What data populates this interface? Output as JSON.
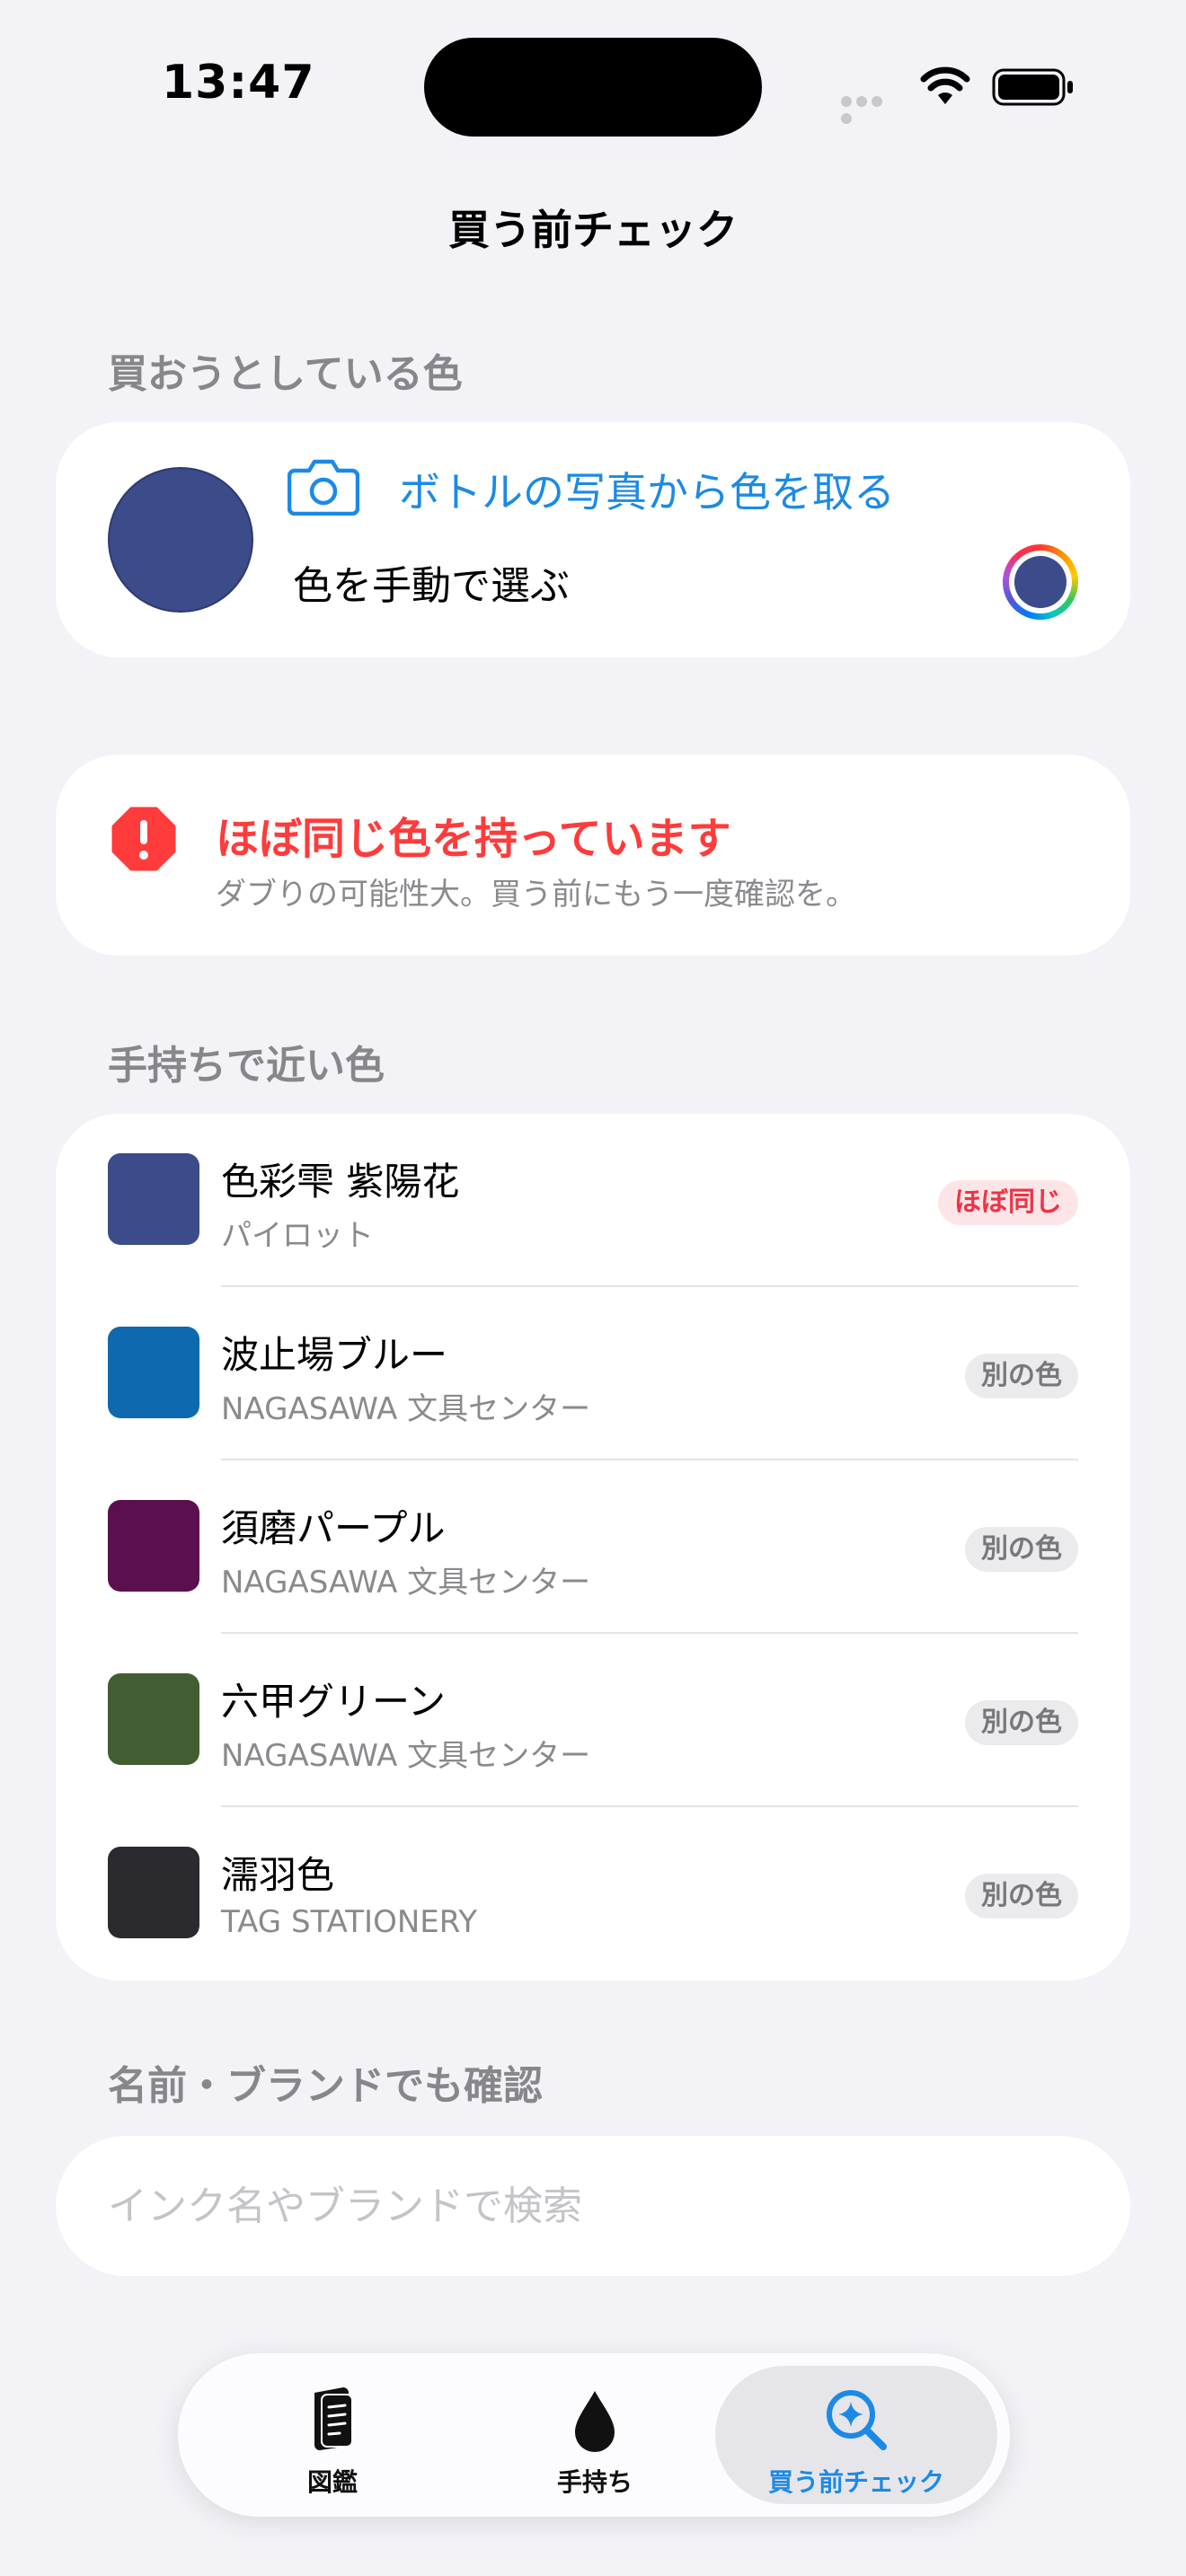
{
  "status_bar": {
    "time": "13:47"
  },
  "nav": {
    "title": "買う前チェック"
  },
  "picker": {
    "section_label": "買おうとしている色",
    "selected_color": "#3c4b89",
    "photo_link": "ボトルの写真から色を取る",
    "manual_label": "色を手動で選ぶ"
  },
  "warning": {
    "title": "ほぼ同じ色を持っています",
    "subtitle": "ダブりの可能性大。買う前にもう一度確認を。",
    "color": "#ff3b3b"
  },
  "owned": {
    "section_label": "手持ちで近い色",
    "items": [
      {
        "name": "色彩雫 紫陽花",
        "brand": "パイロット",
        "color": "#3c4b89",
        "badge": "ほぼ同じ",
        "status": "same"
      },
      {
        "name": "波止場ブルー",
        "brand": "NAGASAWA 文具センター",
        "color": "#0e69ae",
        "badge": "別の色",
        "status": "different"
      },
      {
        "name": "須磨パープル",
        "brand": "NAGASAWA 文具センター",
        "color": "#5c0f4e",
        "badge": "別の色",
        "status": "different"
      },
      {
        "name": "六甲グリーン",
        "brand": "NAGASAWA 文具センター",
        "color": "#425d31",
        "badge": "別の色",
        "status": "different"
      },
      {
        "name": "濡羽色",
        "brand": "TAG STATIONERY",
        "color": "#2b2a2e",
        "badge": "別の色",
        "status": "different"
      }
    ]
  },
  "search": {
    "section_label": "名前・ブランドでも確認",
    "placeholder": "インク名やブランドで検索",
    "value": ""
  },
  "tabs": [
    {
      "label": "図鑑",
      "icon": "book-icon"
    },
    {
      "label": "手持ち",
      "icon": "ink-drop-icon"
    },
    {
      "label": "買う前チェック",
      "icon": "sparkle-search-icon",
      "selected": true
    }
  ],
  "accent_color": "#1b8ae6"
}
